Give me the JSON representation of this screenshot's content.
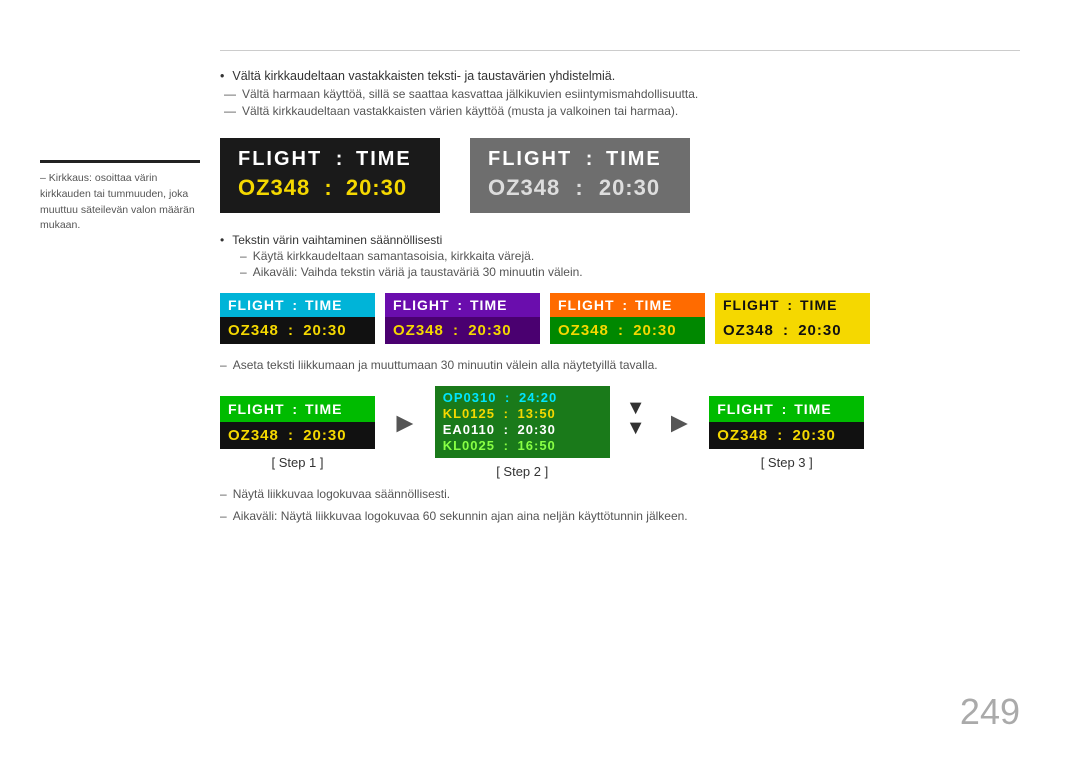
{
  "page": {
    "number": "249"
  },
  "sidebar": {
    "note": "– Kirkkaus: osoittaa värin kirkkauden tai tummuuden, joka muuttuu säteilevän valon määrän mukaan."
  },
  "top_rules_bullets": [
    "Vältä kirkkaudeltaan vastakkaisten teksti- ja taustavärien yhdistelmiä.",
    "Vältä harmaan käyttöä, sillä se saattaa kasvattaa jälkikuvien esiintymismahdollisuutta.",
    "Vältä kirkkaudeltaan vastakkaisten värien käyttöä (musta ja valkoinen tai harmaa)."
  ],
  "boards_row1": {
    "board1": {
      "title": "FLIGHT",
      "colon": ":",
      "subtitle": "TIME",
      "value": "OZ348",
      "colon2": ":",
      "time": "20:30",
      "style": "dark"
    },
    "board2": {
      "title": "FLIGHT",
      "colon": ":",
      "subtitle": "TIME",
      "value": "OZ348",
      "colon2": ":",
      "time": "20:30",
      "style": "gray"
    }
  },
  "text_section": {
    "bullet": "Tekstin värin vaihtaminen säännöllisesti",
    "dash1": "Käytä kirkkaudeltaan samantasoisia, kirkkaita värejä.",
    "dash2": "Aikaväli: Vaihda tekstin väriä ja taustaväriä 30 minuutin välein."
  },
  "color_variants": [
    {
      "top_color": "cyan",
      "bot_color": "black",
      "title": "FLIGHT",
      "colon": ":",
      "subtitle": "TIME",
      "value": "OZ348",
      "value_colon": ":",
      "time": "20:30",
      "title_color": "white",
      "value_color": "yellow"
    },
    {
      "top_color": "purple",
      "bot_color": "purple_dark",
      "title": "FLIGHT",
      "colon": ":",
      "subtitle": "TIME",
      "value": "OZ348",
      "value_colon": ":",
      "time": "20:30",
      "title_color": "white",
      "value_color": "yellow"
    },
    {
      "top_color": "orange",
      "bot_color": "green",
      "title": "FLIGHT",
      "colon": ":",
      "subtitle": "TIME",
      "value": "OZ348",
      "value_colon": ":",
      "time": "20:30",
      "title_color": "white",
      "value_color": "yellow"
    },
    {
      "top_color": "yellow_bg",
      "bot_color": "yellow_bg",
      "title": "FLIGHT",
      "colon": ":",
      "subtitle": "TIME",
      "value": "OZ348",
      "value_colon": ":",
      "time": "20:30",
      "title_color": "dark",
      "value_color": "dark"
    }
  ],
  "note_between": "Aseta teksti liikkumaan ja muuttumaan 30 minuutin välein alla näytetyillä tavalla.",
  "steps": {
    "step1": {
      "label": "[ Step 1 ]",
      "title": "FLIGHT",
      "colon": ":",
      "subtitle": "TIME",
      "value": "OZ348",
      "value_colon": ":",
      "time": "20:30"
    },
    "step2": {
      "label": "[ Step 2 ]",
      "rows": [
        {
          "val1": "OP0310",
          "colon": ":",
          "val2": "24:20"
        },
        {
          "val1": "KL0125",
          "colon": ":",
          "val2": "13:50"
        },
        {
          "val1": "EA0110",
          "colon": ":",
          "val2": "20:30"
        },
        {
          "val1": "KL0025",
          "colon": ":",
          "val2": "16:50"
        }
      ]
    },
    "step3": {
      "label": "[ Step 3 ]",
      "title": "FLIGHT",
      "colon": ":",
      "subtitle": "TIME",
      "value": "OZ348",
      "value_colon": ":",
      "time": "20:30"
    }
  },
  "bottom_notes": {
    "dash1": "Näytä liikkuvaa logokuvaa säännöllisesti.",
    "dash2": "Aikaväli: Näytä liikkuvaa logokuvaa 60 sekunnin ajan aina neljän käyttötunnin jälkeen."
  }
}
